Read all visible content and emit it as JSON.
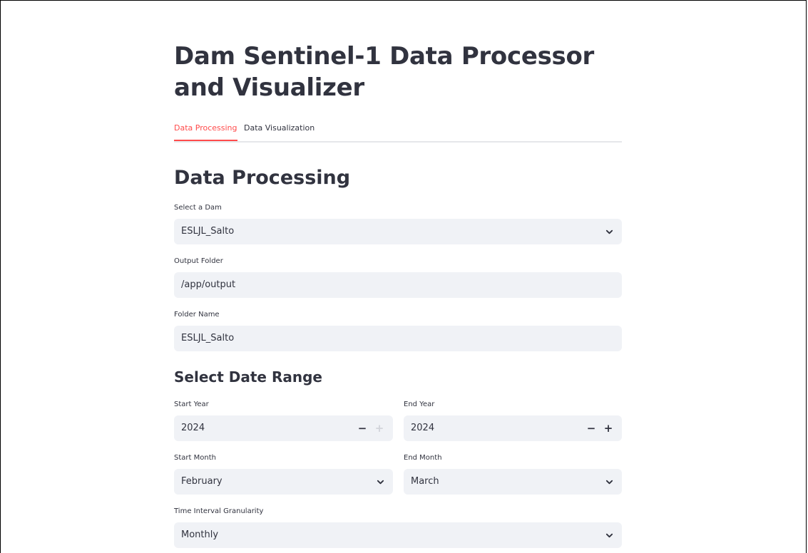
{
  "app": {
    "title": "Dam Sentinel-1 Data Processor and Visualizer"
  },
  "tabs": [
    {
      "label": "Data Processing",
      "active": true
    },
    {
      "label": "Data Visualization",
      "active": false
    }
  ],
  "section": {
    "heading": "Data Processing",
    "dam": {
      "label": "Select a Dam",
      "value": "ESLJL_Salto"
    },
    "output_folder": {
      "label": "Output Folder",
      "value": "/app/output"
    },
    "folder_name": {
      "label": "Folder Name",
      "value": "ESLJL_Salto"
    },
    "date_range": {
      "heading": "Select Date Range",
      "start_year": {
        "label": "Start Year",
        "value": "2024",
        "minus": "−",
        "plus": "+"
      },
      "end_year": {
        "label": "End Year",
        "value": "2024",
        "minus": "−",
        "plus": "+"
      },
      "start_month": {
        "label": "Start Month",
        "value": "February"
      },
      "end_month": {
        "label": "End Month",
        "value": "March"
      }
    },
    "granularity": {
      "label": "Time Interval Granularity",
      "value": "Monthly"
    }
  },
  "colors": {
    "accent": "#ff4b4b",
    "field_bg": "#f0f2f6",
    "text": "#31333f"
  },
  "icons": {
    "select_chevron": "chevron-down-icon",
    "stepper_minus": "minus-icon",
    "stepper_plus": "plus-icon"
  }
}
